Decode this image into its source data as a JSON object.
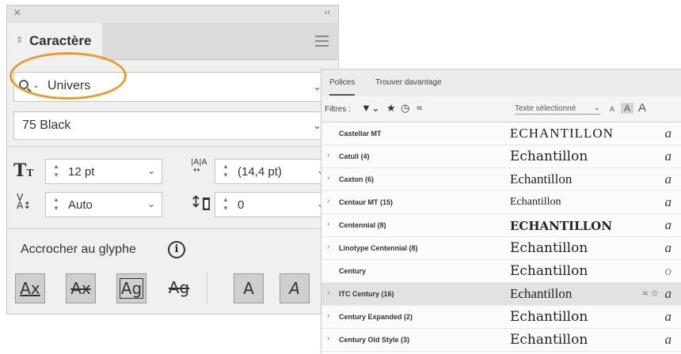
{
  "character_panel": {
    "close_glyph": "×",
    "collapse_glyph": "‹‹",
    "tab_arrows": "⇕",
    "title": "Caractère",
    "font_family": {
      "value": "Univers"
    },
    "font_style": {
      "value": "75 Black"
    },
    "font_size": {
      "value": "12 pt"
    },
    "leading": {
      "value": "(14,4 pt)"
    },
    "kerning": {
      "value": "Auto"
    },
    "tracking": {
      "value": "0"
    },
    "snap_to_glyph": {
      "label": "Accrocher au glyphe"
    },
    "glyph_buttons": [
      {
        "glyph": "Ax",
        "active": true
      },
      {
        "glyph": "Ax",
        "active": true
      },
      {
        "glyph": "Ag",
        "active": true
      },
      {
        "glyph": "Ag",
        "active": false
      },
      {
        "glyph": "A",
        "active": true
      },
      {
        "glyph": "A",
        "active": true
      }
    ],
    "highlight_color": "#ee9a2b"
  },
  "font_browser": {
    "tabs": [
      {
        "label": "Polices",
        "active": true
      },
      {
        "label": "Trouver davantage",
        "active": false
      }
    ],
    "filters_label": "Filtres :",
    "sample_text_select": "Texte sélectionné",
    "size_icons": [
      "A",
      "A",
      "A"
    ],
    "fonts": [
      {
        "name": "Castellar MT",
        "expandable": false,
        "sample": "ECHANTILLON",
        "a": "a"
      },
      {
        "name": "Catull (4)",
        "expandable": true,
        "sample": "Echantillon",
        "a": "a"
      },
      {
        "name": "Caxton (6)",
        "expandable": true,
        "sample": "Echantillon",
        "a": "a"
      },
      {
        "name": "Centaur MT (15)",
        "expandable": true,
        "sample": "Echantillon",
        "a": "a"
      },
      {
        "name": "Centennial (8)",
        "expandable": true,
        "sample": "ECHANTILLON",
        "a": "a"
      },
      {
        "name": "Linotype Centennial (8)",
        "expandable": true,
        "sample": "Echantillon",
        "a": "a"
      },
      {
        "name": "Century",
        "expandable": false,
        "sample": "Echantillon",
        "a": "o"
      },
      {
        "name": "ITC Century (16)",
        "expandable": true,
        "sample": "Echantillon",
        "a": "a",
        "selected": true
      },
      {
        "name": "Century Expanded (2)",
        "expandable": true,
        "sample": "Echantillon",
        "a": "a"
      },
      {
        "name": "Century Old Style (3)",
        "expandable": true,
        "sample": "Echantillon",
        "a": "a"
      }
    ]
  }
}
